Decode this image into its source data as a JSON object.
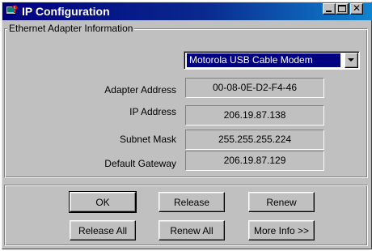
{
  "window": {
    "title": "IP Configuration"
  },
  "title_bar": {
    "minimize_glyph": "_",
    "maximize_glyph": "□",
    "close_glyph": "✕"
  },
  "group": {
    "title": "Ethernet  Adapter Information"
  },
  "adapter_select": {
    "selected": "Motorola USB Cable Modem"
  },
  "info": {
    "adapter_address": {
      "label": "Adapter Address",
      "value": "00-08-0E-D2-F4-46"
    },
    "ip_address": {
      "label": "IP Address",
      "value": "206.19.87.138"
    },
    "subnet_mask": {
      "label": "Subnet Mask",
      "value": "255.255.255.224"
    },
    "default_gateway": {
      "label": "Default Gateway",
      "value": "206.19.87.129"
    }
  },
  "buttons": {
    "ok": "OK",
    "release": "Release",
    "renew": "Renew",
    "release_all": "Release All",
    "renew_all": "Renew All",
    "more_info": "More Info >>"
  },
  "colors": {
    "title_bar_start": "#000080",
    "title_bar_end": "#1084d0",
    "face": "#c0c0c0",
    "selection": "#000080"
  },
  "icons": {
    "app": "network-config-icon",
    "dropdown": "chevron-down-icon"
  }
}
